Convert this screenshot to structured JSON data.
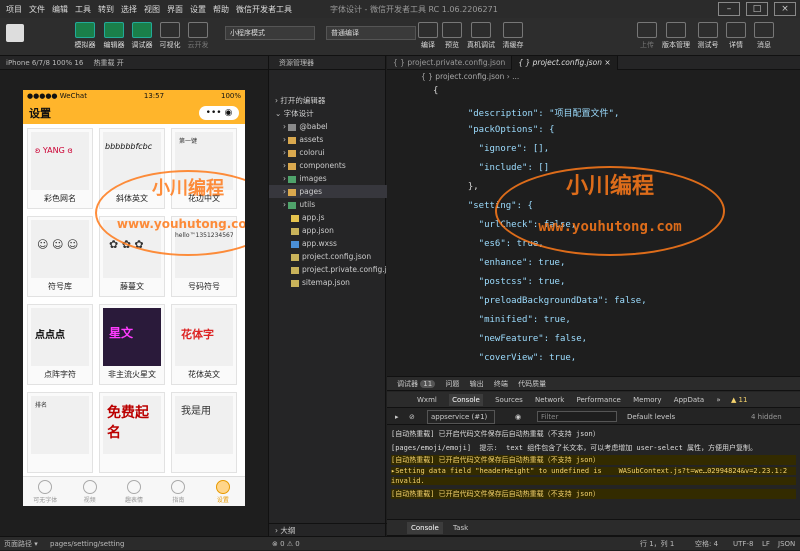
{
  "menu": [
    "项目",
    "文件",
    "编辑",
    "工具",
    "转到",
    "选择",
    "视图",
    "界面",
    "设置",
    "帮助",
    "微信开发者工具"
  ],
  "window_title": "字体设计 - 微信开发者工具 RC 1.06.2206271",
  "toolbar": {
    "simulator": "模拟器",
    "editor": "编辑器",
    "debugger": "调试器",
    "visual": "可视化",
    "cloud": "云开发",
    "mode": "小程序模式",
    "compile_mode": "普通编译",
    "compile": "编译",
    "preview": "预览",
    "real_debug": "真机调试",
    "clear_cache": "清缓存",
    "upload": "上传",
    "version": "版本管理",
    "test": "测试号",
    "details": "详情",
    "messages": "消息"
  },
  "sim_header": {
    "device": "iPhone 6/7/8 100% 16",
    "hot_reload": "热重载 开"
  },
  "phone": {
    "carrier": "●●●●● WeChat",
    "time": "13:57",
    "battery": "100%",
    "title": "设置",
    "capsule": "•••  ◉",
    "cards": [
      {
        "label": "彩色网名",
        "art": "ʚ YANG ɞ"
      },
      {
        "label": "斜体英文",
        "art": "bbbbbbfcbc"
      },
      {
        "label": "花边中文",
        "art": "第一键"
      },
      {
        "label": "符号库",
        "art": "☺ ☺ ☺"
      },
      {
        "label": "藤蔓文",
        "art": "✿ ✿ ✿"
      },
      {
        "label": "号码符号",
        "art": "hello™13512345678"
      },
      {
        "label": "点阵字符",
        "art": "点点点"
      },
      {
        "label": "非主流火星文",
        "art": "星文"
      },
      {
        "label": "花体英文",
        "art": "花体字"
      },
      {
        "label": "",
        "art": "排名"
      },
      {
        "label": "",
        "art": "免费起名"
      },
      {
        "label": "",
        "art": "我是用"
      }
    ],
    "tabs": [
      {
        "label": "可无字体"
      },
      {
        "label": "视频"
      },
      {
        "label": "趣表情"
      },
      {
        "label": "指南"
      },
      {
        "label": "设置"
      }
    ]
  },
  "explorer": {
    "header": "资源管理器",
    "open_editors": "打开的编辑器",
    "project": "字体设计",
    "items": [
      "@babel",
      "assets",
      "colorui",
      "components",
      "images",
      "pages",
      "utils",
      "app.js",
      "app.json",
      "app.wxss",
      "project.config.json",
      "project.private.config.js...",
      "sitemap.json"
    ],
    "outline": "大纲"
  },
  "editor": {
    "tabs": [
      "project.private.config.json",
      "project.config.json"
    ],
    "breadcrumb": "{ } project.config.json › ...",
    "lines": [
      {
        "t": "{"
      },
      {
        "t": "  \"description\": \"项目配置文件\","
      },
      {
        "t": "  \"packOptions\": {"
      },
      {
        "t": "    \"ignore\": [],"
      },
      {
        "t": "    \"include\": []"
      },
      {
        "t": "  },"
      },
      {
        "t": "  \"setting\": {"
      },
      {
        "t": "    \"urlCheck\": false,"
      },
      {
        "t": "    \"es6\": true,"
      },
      {
        "t": "    \"enhance\": true,"
      },
      {
        "t": "    \"postcss\": true,"
      },
      {
        "t": "    \"preloadBackgroundData\": false,"
      },
      {
        "t": "    \"minified\": true,"
      },
      {
        "t": "    \"newFeature\": false,"
      },
      {
        "t": "    \"coverView\": true,"
      }
    ]
  },
  "devtools": {
    "panel_tabs": [
      "调试器",
      "11",
      "问题",
      "输出",
      "终端",
      "代码质量"
    ],
    "tool_tabs": [
      "Wxml",
      "Console",
      "Sources",
      "Network",
      "Performance",
      "Memory",
      "AppData",
      "»"
    ],
    "warn_count": "▲ 11",
    "context": "appservice (#1)",
    "filter": "Filter",
    "levels": "Default levels",
    "hidden": "4 hidden",
    "messages": [
      {
        "text": "[自动热重载] 已开启代码文件保存后自动热重载（不支持 json）",
        "level": "info"
      },
      {
        "text": "[pages/emoji/emoji]  提示:  text 组件包含了长文本，可以考虑增加 user-select 属性，方便用户复制。",
        "level": "log"
      },
      {
        "text": "[自动热重载] 已开启代码文件保存后自动热重载（不支持 json）",
        "level": "warn"
      },
      {
        "text": "▸Setting data field \"headerHeight\" to undefined is    WASubContext.js?t=we…02994824&v=2.23.1:2",
        "level": "warn"
      },
      {
        "text": "invalid.",
        "level": "warn"
      },
      {
        "text": "[自动热重载] 已开启代码文件保存后自动热重载（不支持 json）",
        "level": "warn"
      }
    ],
    "bottom_tabs": [
      "Console",
      "Task"
    ]
  },
  "statusbar": {
    "path_label": "页面路径 ▾",
    "path": "pages/setting/setting",
    "errors": "⊗ 0 ⚠ 0",
    "position": "行 1，列 1",
    "spaces": "空格: 4",
    "encoding": "UTF-8",
    "eol": "LF",
    "lang": "JSON"
  },
  "watermark": {
    "cn": "小川编程",
    "url": "www.youhutong.com"
  },
  "colors": {
    "accent": "#ffb52b",
    "watermark": "#ff7a1a"
  }
}
